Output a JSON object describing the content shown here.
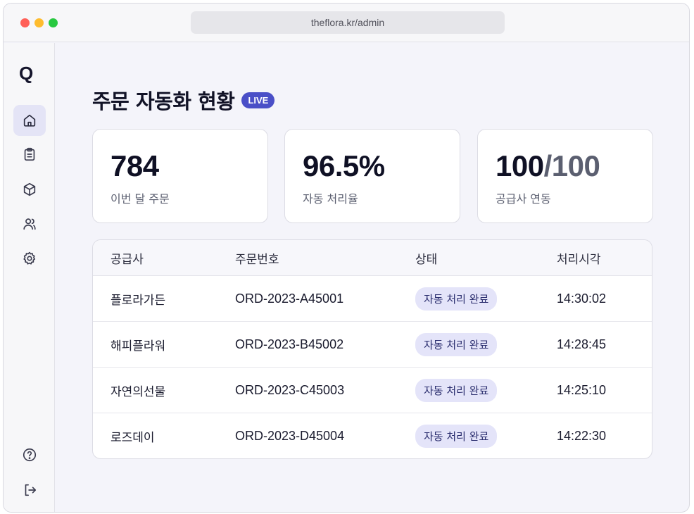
{
  "browser": {
    "url": "theflora.kr/admin"
  },
  "sidebar": {
    "logo": "Q",
    "items": [
      {
        "icon": "home-icon"
      },
      {
        "icon": "clipboard-icon"
      },
      {
        "icon": "package-icon"
      },
      {
        "icon": "users-icon"
      },
      {
        "icon": "settings-icon"
      }
    ],
    "bottom": [
      {
        "icon": "help-icon"
      },
      {
        "icon": "logout-icon"
      }
    ]
  },
  "header": {
    "title": "주문 자동화 현황",
    "badge": "LIVE"
  },
  "stats": [
    {
      "value": "784",
      "label": "이번 달 주문"
    },
    {
      "value": "96.5%",
      "label": "자동 처리율"
    },
    {
      "value_main": "100",
      "value_muted": "/100",
      "label": "공급사 연동"
    }
  ],
  "table": {
    "headers": [
      "공급사",
      "주문번호",
      "상태",
      "처리시각"
    ],
    "rows": [
      {
        "supplier": "플로라가든",
        "order": "ORD-2023-A45001",
        "status": "자동 처리 완료",
        "time": "14:30:02"
      },
      {
        "supplier": "해피플라워",
        "order": "ORD-2023-B45002",
        "status": "자동 처리 완료",
        "time": "14:28:45"
      },
      {
        "supplier": "자연의선물",
        "order": "ORD-2023-C45003",
        "status": "자동 처리 완료",
        "time": "14:25:10"
      },
      {
        "supplier": "로즈데이",
        "order": "ORD-2023-D45004",
        "status": "자동 처리 완료",
        "time": "14:22:30"
      }
    ]
  },
  "colors": {
    "accent": "#4a4fc7",
    "pill_bg": "#e4e4f9",
    "background": "#f4f4fa"
  }
}
